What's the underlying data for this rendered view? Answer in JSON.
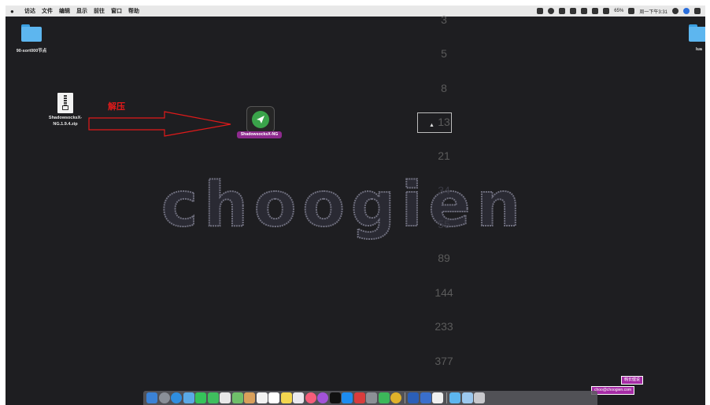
{
  "menubar": {
    "apple": "",
    "items": [
      "访达",
      "文件",
      "编辑",
      "显示",
      "前往",
      "窗口",
      "帮助"
    ],
    "status_text": "65%",
    "clock": "周一下午3:31"
  },
  "desktop": {
    "folder_left_label": "90-sort000节点",
    "folder_right_label": "lua",
    "zip_label_line1": "ShadowsocksX-",
    "zip_label_line2": "NG.1.9.4.zip",
    "app_label": "ShadowsocksX-NG",
    "annotation": "解压"
  },
  "numbers": [
    "3",
    "5",
    "8",
    "13",
    "21",
    "34",
    "55",
    "89",
    "144",
    "233",
    "377"
  ],
  "watermark": "choogien",
  "badges": {
    "name_cn": "韩长健说",
    "email": "choo@choogien.com"
  },
  "colors": {
    "desktop_bg": "#1e1e21",
    "annotation_red": "#e11a1a",
    "highlight_purple": "#8e2a8e",
    "folder_blue": "#5db6ef",
    "app_green": "#3aa34a"
  },
  "dock_icons": [
    "finder-icon",
    "launchpad-icon",
    "safari-icon",
    "mail-icon",
    "messages-icon",
    "facetime-icon",
    "photos-icon",
    "maps-icon",
    "contacts-icon",
    "calendar-icon",
    "reminders-icon",
    "notes-icon",
    "itunes-icon",
    "music-icon",
    "podcasts-icon",
    "tv-icon",
    "appstore-icon",
    "system-prefs-icon",
    "chrome-icon",
    "wechat-icon",
    "word-icon",
    "qq-icon",
    "textedit-icon",
    "folder-icon",
    "downloads-icon",
    "trash-icon"
  ]
}
